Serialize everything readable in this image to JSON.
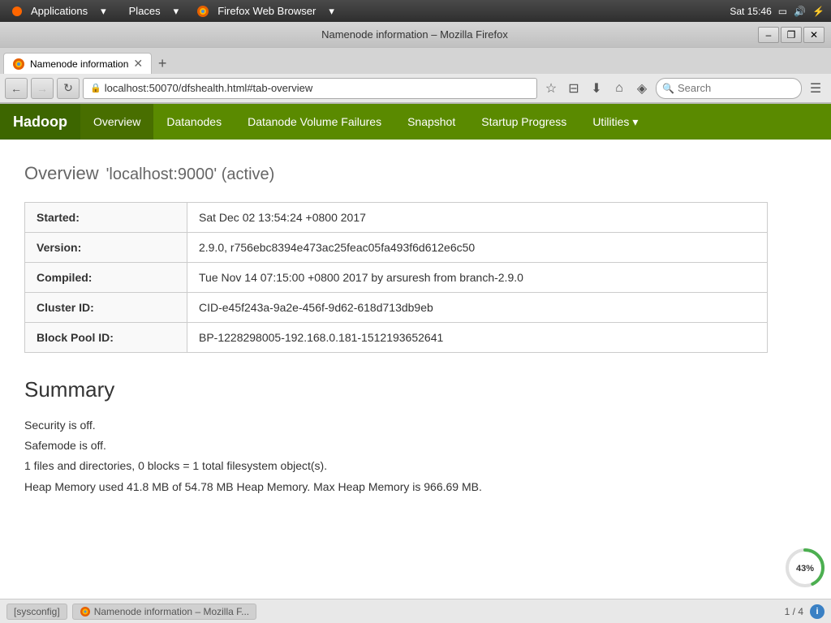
{
  "os": {
    "app_menu": "Applications",
    "places_menu": "Places",
    "browser_name": "Firefox Web Browser",
    "time": "Sat 15:46",
    "app_menu_arrow": "▾",
    "places_arrow": "▾",
    "browser_arrow": "▾"
  },
  "browser": {
    "title": "Namenode information – Mozilla Firefox",
    "tab_label": "Namenode information",
    "url": "localhost:50070/dfshealth.html#tab-overview",
    "search_placeholder": "Search",
    "win_minimize": "–",
    "win_restore": "❐",
    "win_close": "✕"
  },
  "hadoop_nav": {
    "logo": "Hadoop",
    "items": [
      {
        "label": "Overview",
        "active": true
      },
      {
        "label": "Datanodes",
        "active": false
      },
      {
        "label": "Datanode Volume Failures",
        "active": false
      },
      {
        "label": "Snapshot",
        "active": false
      },
      {
        "label": "Startup Progress",
        "active": false
      },
      {
        "label": "Utilities ▾",
        "active": false
      }
    ]
  },
  "page": {
    "title": "Overview",
    "subtitle": "'localhost:9000' (active)",
    "info_table": {
      "rows": [
        {
          "label": "Started:",
          "value": "Sat Dec 02 13:54:24 +0800 2017"
        },
        {
          "label": "Version:",
          "value": "2.9.0, r756ebc8394e473ac25feac05fa493f6d612e6c50"
        },
        {
          "label": "Compiled:",
          "value": "Tue Nov 14 07:15:00 +0800 2017 by arsuresh from branch-2.9.0"
        },
        {
          "label": "Cluster ID:",
          "value": "CID-e45f243a-9a2e-456f-9d62-618d713db9eb"
        },
        {
          "label": "Block Pool ID:",
          "value": "BP-1228298005-192.168.0.181-1512193652641"
        }
      ]
    },
    "summary_title": "Summary",
    "summary_lines": [
      "Security is off.",
      "Safemode is off.",
      "1 files and directories, 0 blocks = 1 total filesystem object(s).",
      "Heap Memory used 41.8 MB of 54.78 MB Heap Memory. Max Heap Memory is 966.69 MB."
    ]
  },
  "progress": {
    "percent": "43%",
    "circumference": 138.23,
    "fill": 59.44
  },
  "statusbar": {
    "task_label": "[sysconfig]",
    "browser_task": "Namenode information – Mozilla F...",
    "page_counter": "1 / 4"
  }
}
